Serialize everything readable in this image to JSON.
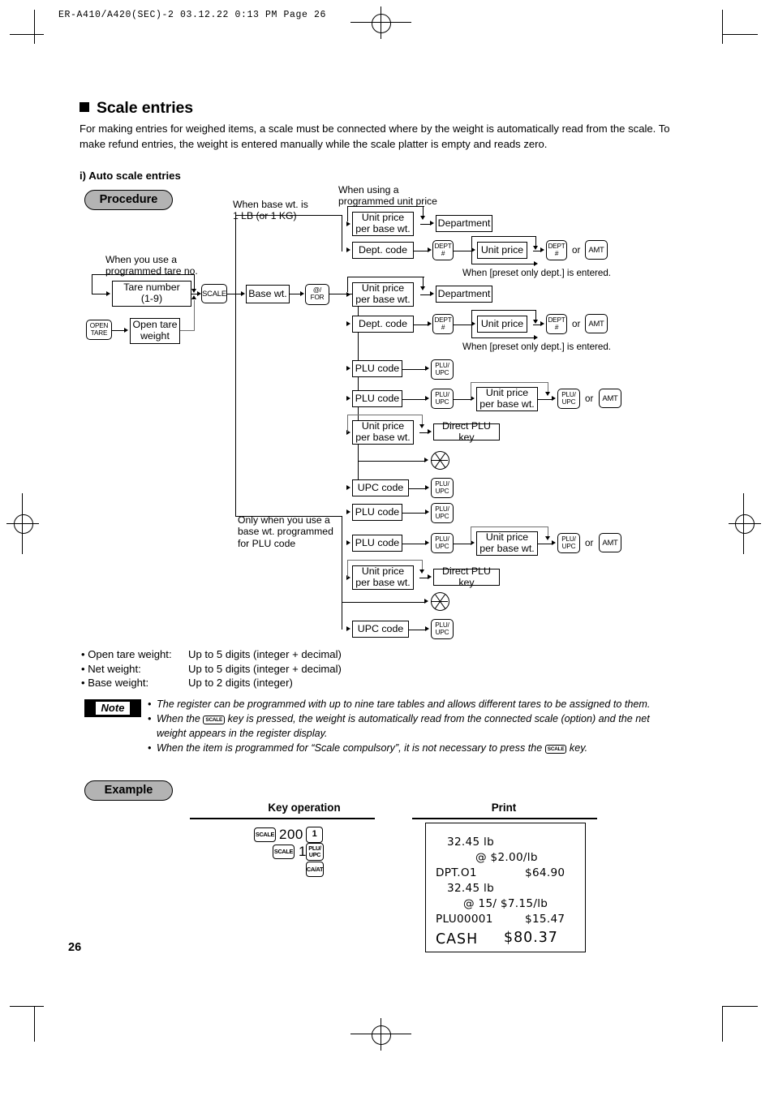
{
  "print_header": "ER-A410/A420(SEC)-2   03.12.22 0:13 PM   Page 26",
  "section": {
    "title": "Scale entries",
    "intro": "For making entries for weighed items, a scale must be connected where by the weight is automatically read from the scale. To make refund entries, the weight is entered manually while the scale platter is empty and reads zero.",
    "subhead": "i) Auto scale entries"
  },
  "badges": {
    "procedure": "Procedure",
    "example": "Example",
    "note": "Note"
  },
  "flow": {
    "labels": {
      "when_base_wt": "When base wt. is\n1 LB (or 1 KG)",
      "when_programmed_unit_price": "When using a\nprogrammed unit price",
      "when_programmed_tare": "When you use a\nprogrammed tare no.",
      "only_when_base_wt": "Only when you use a\nbase wt. programmed\nfor PLU code",
      "preset_only_dept": "When [preset only dept.] is entered."
    },
    "boxes": {
      "tare_number": "Tare number\n(1-9)",
      "open_tare_weight": "Open tare\nweight",
      "base_wt": "Base wt.",
      "unit_price_per_base_wt": "Unit price\nper base wt.",
      "department": "Department",
      "dept_code": "Dept. code",
      "unit_price": "Unit price",
      "plu_code": "PLU code",
      "upc_code": "UPC code",
      "direct_plu_key": "Direct PLU key"
    },
    "keys": {
      "scale": "SCALE",
      "open_tare": [
        "OPEN",
        "TARE"
      ],
      "at_for": [
        "@/",
        "FOR"
      ],
      "dept_hash": [
        "DEPT",
        "#"
      ],
      "amt": "AMT",
      "plu_upc": [
        "PLU/",
        "UPC"
      ]
    },
    "or_label": "or"
  },
  "specs": [
    {
      "key": "• Open tare weight:",
      "value": "Up to 5 digits (integer + decimal)"
    },
    {
      "key": "• Net weight:",
      "value": "Up to 5 digits (integer + decimal)"
    },
    {
      "key": "• Base weight:",
      "value": "Up to 2 digits (integer)"
    }
  ],
  "notes": [
    {
      "before": "The register can be programmed with up to nine tare tables and allows different tares to be assigned to them.",
      "key": "",
      "after": ""
    },
    {
      "before": "When the ",
      "key": "SCALE",
      "after": " key is pressed, the weight is automatically read from the connected scale (option) and the net weight appears in the register display."
    },
    {
      "before": "When the item is programmed for “Scale compulsory”, it is not necessary to press the ",
      "key": "SCALE",
      "after": " key."
    }
  ],
  "example": {
    "key_operation_title": "Key operation",
    "print_title": "Print",
    "sequence": [
      {
        "type": "key",
        "lines": [
          "SCALE"
        ]
      },
      {
        "type": "num",
        "text": "200"
      },
      {
        "type": "key",
        "lines": [
          "1"
        ]
      },
      {
        "type": "key",
        "lines": [
          "SCALE"
        ]
      },
      {
        "type": "num",
        "text": "1"
      },
      {
        "type": "key",
        "lines": [
          "PLU/",
          "UPC"
        ]
      },
      {
        "type": "key",
        "lines": [
          "CA/AT"
        ]
      }
    ],
    "receipt_lines": [
      "32.45 lb",
      "@ $2.00/lb",
      "DPT.O1",
      "$64.90",
      "32.45 lb",
      "@ 15/ $7.15/lb",
      "PLU00001",
      "$15.47",
      "CASH",
      "$80.37"
    ]
  },
  "page_number": "26"
}
